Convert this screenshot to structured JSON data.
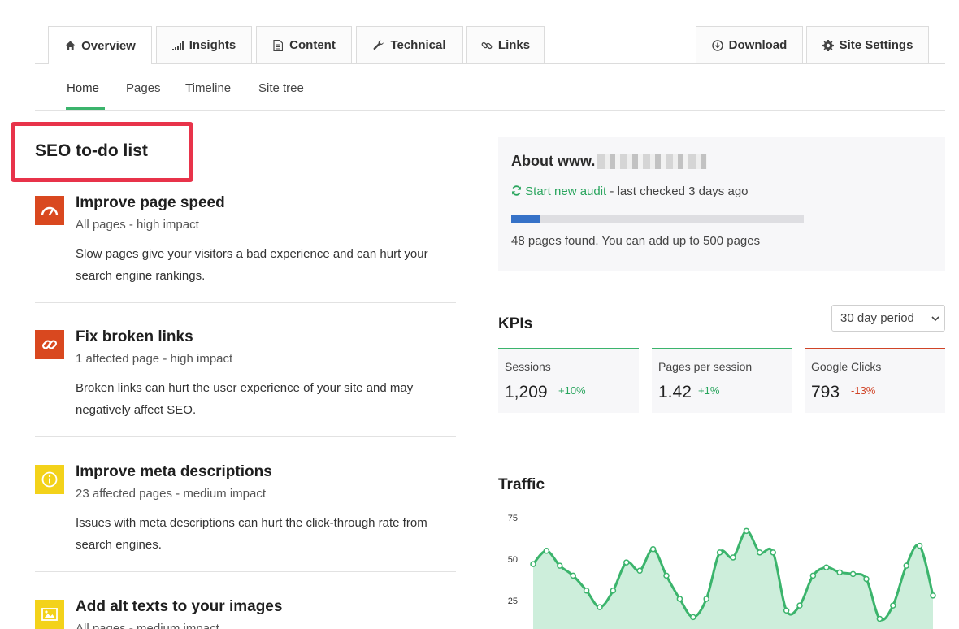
{
  "tabs_left": [
    {
      "label": "Overview",
      "icon": "home-icon"
    },
    {
      "label": "Insights",
      "icon": "signal-icon"
    },
    {
      "label": "Content",
      "icon": "document-icon"
    },
    {
      "label": "Technical",
      "icon": "wrench-icon"
    },
    {
      "label": "Links",
      "icon": "link-icon"
    }
  ],
  "tabs_right": [
    {
      "label": "Download",
      "icon": "download-icon"
    },
    {
      "label": "Site Settings",
      "icon": "gear-icon"
    }
  ],
  "subnav": [
    "Home",
    "Pages",
    "Timeline",
    "Site tree"
  ],
  "todo": {
    "title": "SEO to-do list",
    "items": [
      {
        "title": "Improve page speed",
        "meta": "All pages - high impact",
        "desc": "Slow pages give your visitors a bad experience and can hurt your search engine rankings.",
        "color": "#d9481f",
        "icon": "speedometer-icon"
      },
      {
        "title": "Fix broken links",
        "meta": "1 affected page - high impact",
        "desc": "Broken links can hurt the user experience of your site and may negatively affect SEO.",
        "color": "#d9481f",
        "icon": "link-icon"
      },
      {
        "title": "Improve meta descriptions",
        "meta": "23 affected pages - medium impact",
        "desc": "Issues with meta descriptions can hurt the click-through rate from search engines.",
        "color": "#f3d21a",
        "icon": "info-icon"
      },
      {
        "title": "Add alt texts to your images",
        "meta": "All pages - medium impact",
        "desc": "",
        "color": "#f3d21a",
        "icon": "image-icon"
      }
    ]
  },
  "about": {
    "title": "About www.",
    "audit_link": "Start new audit",
    "last_checked": " - last checked 3 days ago",
    "progress": 0.096,
    "pages_found": "48 pages found. You can add up to 500 pages"
  },
  "kpis": {
    "title": "KPIs",
    "period": "30 day period",
    "items": [
      {
        "label": "Sessions",
        "value": "1,209",
        "change": "+10%",
        "trend": "up"
      },
      {
        "label": "Pages per session",
        "value": "1.42",
        "change": "+1%",
        "trend": "up"
      },
      {
        "label": "Google Clicks",
        "value": "793",
        "change": "-13%",
        "trend": "down"
      }
    ]
  },
  "traffic": {
    "title": "Traffic"
  },
  "chart_data": {
    "type": "area",
    "title": "Traffic",
    "xlabel": "",
    "ylabel": "",
    "ylim": [
      0,
      75
    ],
    "yticks": [
      25,
      50,
      75
    ],
    "color": "#3bb46c",
    "grid": false,
    "x": [
      1,
      2,
      3,
      4,
      5,
      6,
      7,
      8,
      9,
      10,
      11,
      12,
      13,
      14,
      15,
      16,
      17,
      18,
      19,
      20,
      21,
      22,
      23,
      24,
      25,
      26,
      27,
      28,
      29,
      30
    ],
    "series": [
      {
        "values": [
          47,
          55,
          46,
          40,
          31,
          21,
          31,
          48,
          43,
          56,
          40,
          26,
          15,
          26,
          54,
          51,
          67,
          54,
          54,
          19,
          22,
          40,
          45,
          42,
          41,
          38,
          14,
          22,
          46,
          58,
          28
        ]
      }
    ]
  }
}
